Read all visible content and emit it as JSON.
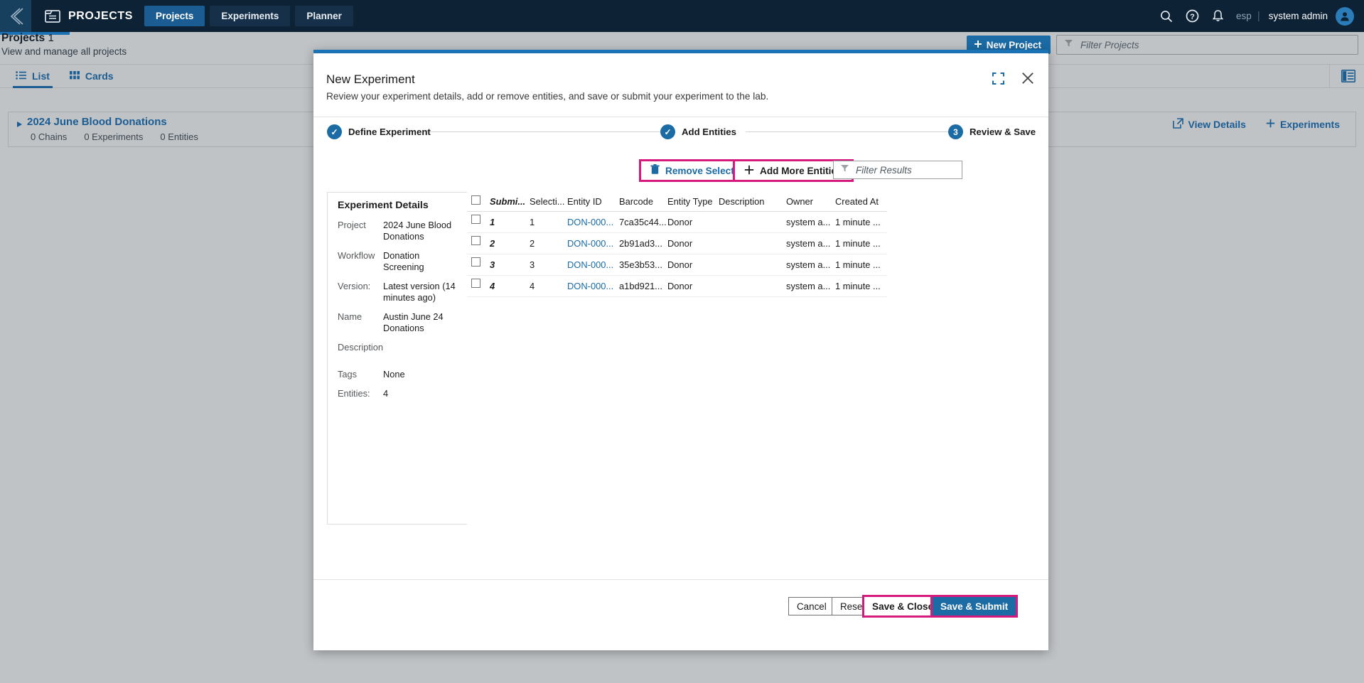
{
  "topnav": {
    "back_icon": "chevron-left-icon",
    "app_icon": "projects-app-icon",
    "app_title": "PROJECTS",
    "tabs": [
      {
        "label": "Projects",
        "active": true
      },
      {
        "label": "Experiments",
        "active": false
      },
      {
        "label": "Planner",
        "active": false
      }
    ],
    "search_icon": "search-icon",
    "help_icon": "help-icon",
    "notifications_icon": "bell-icon",
    "language": "esp",
    "separator": "|",
    "username": "system admin",
    "avatar_icon": "user-avatar-icon"
  },
  "page": {
    "title": "Projects",
    "count": "1",
    "subtitle": "View and manage all projects",
    "new_project_label": "New Project",
    "new_project_icon": "plus-icon",
    "filter_icon": "funnel-icon",
    "filter_placeholder": "Filter Projects"
  },
  "viewtabs": {
    "items": [
      {
        "label": "List",
        "icon": "list-icon",
        "active": true
      },
      {
        "label": "Cards",
        "icon": "grid-icon",
        "active": false
      }
    ],
    "panel_toggle_icon": "side-panel-icon"
  },
  "project_row": {
    "caret_icon": "caret-right-icon",
    "name": "2024 June Blood Donations",
    "stats": [
      "0 Chains",
      "0 Experiments",
      "0 Entities"
    ],
    "actions": [
      {
        "label": "View Details",
        "icon": "external-link-icon"
      },
      {
        "label": "Experiments",
        "icon": "plus-icon"
      }
    ]
  },
  "modal": {
    "title": "New Experiment",
    "subtitle": "Review your experiment details, add or remove entities, and save or submit your experiment to the lab.",
    "expand_icon": "expand-icon",
    "close_icon": "close-icon",
    "steps": [
      {
        "label": "Define Experiment",
        "badge": "✓",
        "state": "complete"
      },
      {
        "label": "Add Entities",
        "badge": "✓",
        "state": "complete"
      },
      {
        "label": "Review & Save",
        "badge": "3",
        "state": "current"
      }
    ],
    "toolbar": {
      "remove_selected_label": "Remove Selected",
      "remove_selected_icon": "trash-icon",
      "add_more_label": "Add More Entities",
      "add_more_icon": "plus-icon",
      "filter_icon": "funnel-icon",
      "filter_placeholder": "Filter Results"
    },
    "details": {
      "title": "Experiment Details",
      "rows": [
        {
          "key": "Project",
          "value": "2024 June Blood Donations"
        },
        {
          "key": "Workflow",
          "value": "Donation Screening"
        },
        {
          "key": "Version:",
          "value": "Latest version (14 minutes ago)"
        },
        {
          "key": "Name",
          "value": "Austin June 24 Donations"
        },
        {
          "key": "Description",
          "value": ""
        },
        {
          "key": "Tags",
          "value": "None"
        },
        {
          "key": "Entities:",
          "value": "4"
        }
      ]
    },
    "table": {
      "select_all_checkbox": false,
      "columns": [
        "Submi...",
        "Selecti...",
        "Entity ID",
        "Barcode",
        "Entity Type",
        "Description",
        "Owner",
        "Created At"
      ],
      "sorted_column": "Submi...",
      "rows": [
        {
          "checked": false,
          "submission": "1",
          "selection": "1",
          "entity_id": "DON-000...",
          "barcode": "7ca35c44...",
          "entity_type": "Donor",
          "description": "",
          "owner": "system a...",
          "created_at": "1 minute ..."
        },
        {
          "checked": false,
          "submission": "2",
          "selection": "2",
          "entity_id": "DON-000...",
          "barcode": "2b91ad3...",
          "entity_type": "Donor",
          "description": "",
          "owner": "system a...",
          "created_at": "1 minute ..."
        },
        {
          "checked": false,
          "submission": "3",
          "selection": "3",
          "entity_id": "DON-000...",
          "barcode": "35e3b53...",
          "entity_type": "Donor",
          "description": "",
          "owner": "system a...",
          "created_at": "1 minute ..."
        },
        {
          "checked": false,
          "submission": "4",
          "selection": "4",
          "entity_id": "DON-000...",
          "barcode": "a1bd921...",
          "entity_type": "Donor",
          "description": "",
          "owner": "system a...",
          "created_at": "1 minute ..."
        }
      ]
    },
    "footer": {
      "cancel_label": "Cancel",
      "reset_label": "Reset",
      "save_close_label": "Save & Close",
      "save_submit_label": "Save & Submit"
    }
  },
  "colors": {
    "nav_bg": "#0d2235",
    "accent_blue": "#1b6ba5",
    "link_blue": "#1b5d92",
    "highlight_pink": "#d6197d",
    "page_bg": "#c0c3c6"
  }
}
